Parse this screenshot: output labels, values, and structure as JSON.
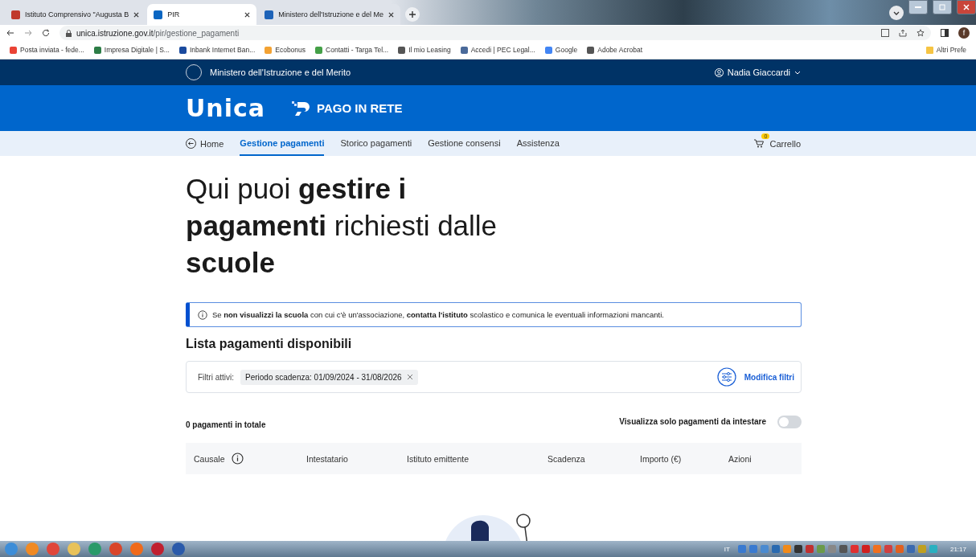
{
  "browser": {
    "tabs": [
      {
        "title": "Istituto Comprensivo \"Augusta B",
        "selected": false
      },
      {
        "title": "PIR",
        "selected": true
      },
      {
        "title": "Ministero dell'Istruzione e del Me",
        "selected": false
      }
    ],
    "url_host": "unica.istruzione.gov.it",
    "url_path": "/pir/gestione_pagamenti",
    "profile": "f",
    "bookmarks": [
      {
        "label": "Posta inviata - fede..."
      },
      {
        "label": "Impresa Digitale | S..."
      },
      {
        "label": "Inbank Internet Ban..."
      },
      {
        "label": "Ecobonus"
      },
      {
        "label": "Contatti - Targa Tel..."
      },
      {
        "label": "Il mio Leasing"
      },
      {
        "label": "Accedi | PEC Legal..."
      },
      {
        "label": "Google"
      },
      {
        "label": "Adobe Acrobat"
      }
    ],
    "other_bookmarks": "Altri Prefe"
  },
  "topbar": {
    "ministry": "Ministero dell'Istruzione e del Merito",
    "user": "Nadia Giaccardi"
  },
  "brand": {
    "logo": "Unica",
    "service": "PAGO IN RETE"
  },
  "nav": {
    "home": "Home",
    "items": [
      {
        "label": "Gestione pagamenti",
        "selected": true
      },
      {
        "label": "Storico pagamenti",
        "selected": false
      },
      {
        "label": "Gestione consensi",
        "selected": false
      },
      {
        "label": "Assistenza",
        "selected": false
      }
    ],
    "cart_count": "0",
    "cart": "Carrello"
  },
  "heading": "Qui puoi **gestire i pagamenti** richiesti dalle **scuole**",
  "notice": "Se **non visualizzi la scuola** con cui c'è un'associazione, **contatta l'istituto** scolastico e comunica le eventuali informazioni mancanti.",
  "list_title": "Lista pagamenti disponibili",
  "filters": {
    "label": "Filtri attivi:",
    "chips": [
      "Periodo scadenza: 01/09/2024 - 31/08/2026"
    ],
    "edit": "Modifica filtri"
  },
  "total": "0 pagamenti in totale",
  "toggle": {
    "label": "Visualizza solo pagamenti da intestare",
    "on": false
  },
  "table": {
    "columns": [
      {
        "label": "Causale",
        "kind": "info"
      },
      {
        "label": "Intestatario",
        "kind": "plain"
      },
      {
        "label": "Istituto emittente",
        "kind": "plain"
      },
      {
        "label": "Scadenza",
        "kind": "plain"
      },
      {
        "label": "Importo (€)",
        "kind": "plain"
      },
      {
        "label": "Azioni",
        "kind": "plain"
      }
    ]
  },
  "taskbar": {
    "language": "IT",
    "time": "21:17"
  }
}
